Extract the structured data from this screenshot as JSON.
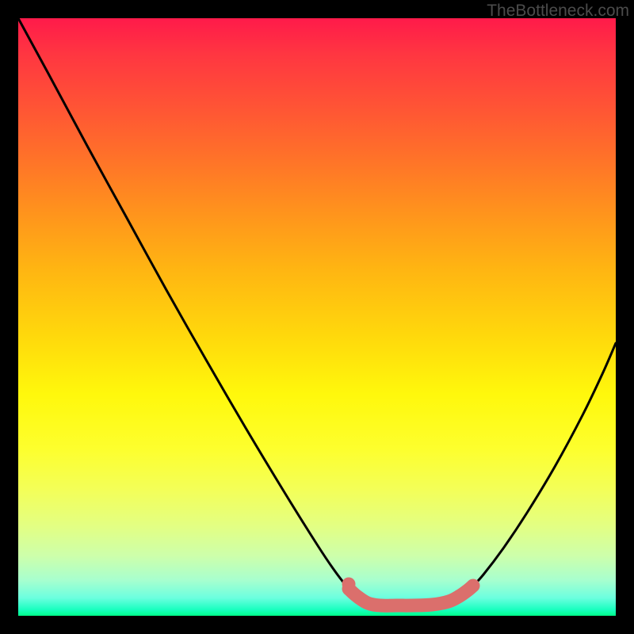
{
  "watermark": "TheBottleneck.com",
  "chart_data": {
    "type": "line",
    "title": "",
    "xlabel": "",
    "ylabel": "",
    "xlim": [
      23,
      777
    ],
    "ylim": [
      23,
      777
    ],
    "background_gradient": {
      "top": "#ff1a4a",
      "bottom": "#00ff8a"
    },
    "series": [
      {
        "name": "curve",
        "stroke": "#000000",
        "stroke_width": 3,
        "points": [
          {
            "x": 23,
            "y": 23
          },
          {
            "x": 60,
            "y": 91
          },
          {
            "x": 110,
            "y": 184
          },
          {
            "x": 160,
            "y": 275
          },
          {
            "x": 210,
            "y": 366
          },
          {
            "x": 260,
            "y": 454
          },
          {
            "x": 310,
            "y": 540
          },
          {
            "x": 360,
            "y": 623
          },
          {
            "x": 400,
            "y": 687
          },
          {
            "x": 420,
            "y": 717
          },
          {
            "x": 436,
            "y": 738
          },
          {
            "x": 450,
            "y": 752
          },
          {
            "x": 463,
            "y": 760
          },
          {
            "x": 477,
            "y": 763
          },
          {
            "x": 498,
            "y": 764
          },
          {
            "x": 520,
            "y": 764
          },
          {
            "x": 545,
            "y": 763
          },
          {
            "x": 566,
            "y": 759
          },
          {
            "x": 582,
            "y": 751
          },
          {
            "x": 596,
            "y": 740
          },
          {
            "x": 610,
            "y": 725
          },
          {
            "x": 635,
            "y": 692
          },
          {
            "x": 665,
            "y": 647
          },
          {
            "x": 700,
            "y": 589
          },
          {
            "x": 735,
            "y": 524
          },
          {
            "x": 760,
            "y": 472
          },
          {
            "x": 777,
            "y": 433
          }
        ]
      },
      {
        "name": "highlight-zone",
        "stroke": "#db6f6c",
        "stroke_width": 17,
        "points": [
          {
            "x": 440,
            "y": 743
          },
          {
            "x": 450,
            "y": 752
          },
          {
            "x": 464,
            "y": 761
          },
          {
            "x": 480,
            "y": 764
          },
          {
            "x": 500,
            "y": 764
          },
          {
            "x": 520,
            "y": 764
          },
          {
            "x": 545,
            "y": 763
          },
          {
            "x": 566,
            "y": 759
          },
          {
            "x": 580,
            "y": 752
          },
          {
            "x": 590,
            "y": 745
          },
          {
            "x": 597,
            "y": 739
          }
        ]
      }
    ]
  }
}
